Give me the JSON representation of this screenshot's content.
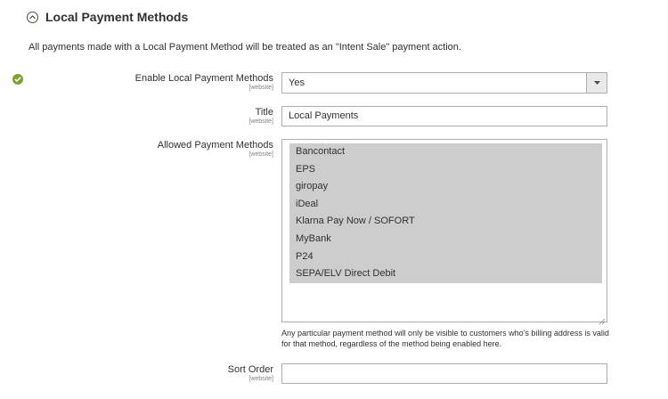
{
  "section": {
    "title": "Local Payment Methods",
    "note": "All payments made with a Local Payment Method will be treated as an \"Intent Sale\" payment action."
  },
  "fields": {
    "enable": {
      "label": "Enable Local Payment Methods",
      "scope": "[website]",
      "value": "Yes"
    },
    "title": {
      "label": "Title",
      "scope": "[website]",
      "value": "Local Payments"
    },
    "allowed": {
      "label": "Allowed Payment Methods",
      "scope": "[website]",
      "options": [
        "Bancontact",
        "EPS",
        "giropay",
        "iDeal",
        "Klarna Pay Now / SOFORT",
        "MyBank",
        "P24",
        "SEPA/ELV Direct Debit"
      ],
      "comment": "Any particular payment method will only be visible to customers who's billing address is valid for that method, regardless of the method being enabled here."
    },
    "sort_order": {
      "label": "Sort Order",
      "scope": "[website]",
      "value": ""
    }
  },
  "colors": {
    "check": "#79a22e",
    "selected_option_bg": "#cdcdcd",
    "border": "#adadad"
  },
  "icons": {
    "collapse": "chevron-up-circle-icon",
    "status": "checkmark-circle-icon",
    "dropdown": "triangle-down-icon"
  }
}
